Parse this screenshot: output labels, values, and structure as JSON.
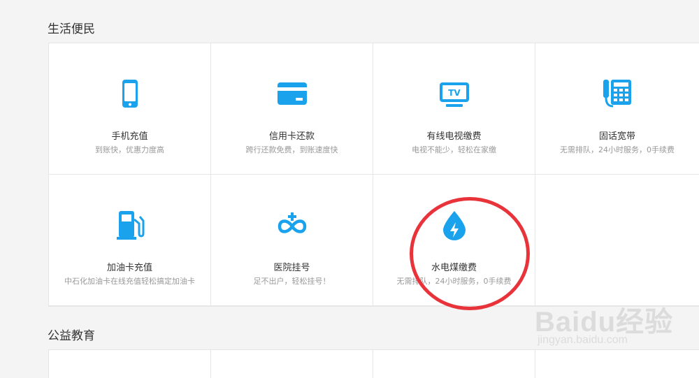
{
  "sections": [
    {
      "title": "生活便民",
      "items": [
        {
          "name": "手机充值",
          "desc": "到账快，优惠力度高",
          "icon": "phone-icon"
        },
        {
          "name": "信用卡还款",
          "desc": "跨行还款免费，到账速度快",
          "icon": "credit-card-icon"
        },
        {
          "name": "有线电视缴费",
          "desc": "电视不能少，轻松在家缴",
          "icon": "tv-icon"
        },
        {
          "name": "固话宽带",
          "desc": "无需排队，24小时服务，0手续费",
          "icon": "telephone-icon"
        },
        {
          "name": "加油卡充值",
          "desc": "中石化加油卡在线充值轻松搞定加油卡",
          "icon": "fuel-pump-icon"
        },
        {
          "name": "医院挂号",
          "desc": "足不出户，轻松挂号！",
          "icon": "hospital-icon"
        },
        {
          "name": "水电煤缴费",
          "desc": "无需排队，24小时服务，0手续费",
          "icon": "utility-drop-icon"
        }
      ]
    },
    {
      "title": "公益教育"
    }
  ],
  "watermark": {
    "brand": "Baidu经验",
    "url": "jingyan.baidu.com"
  },
  "colors": {
    "icon": "#1aa3ec",
    "annotation": "#e8333a"
  }
}
